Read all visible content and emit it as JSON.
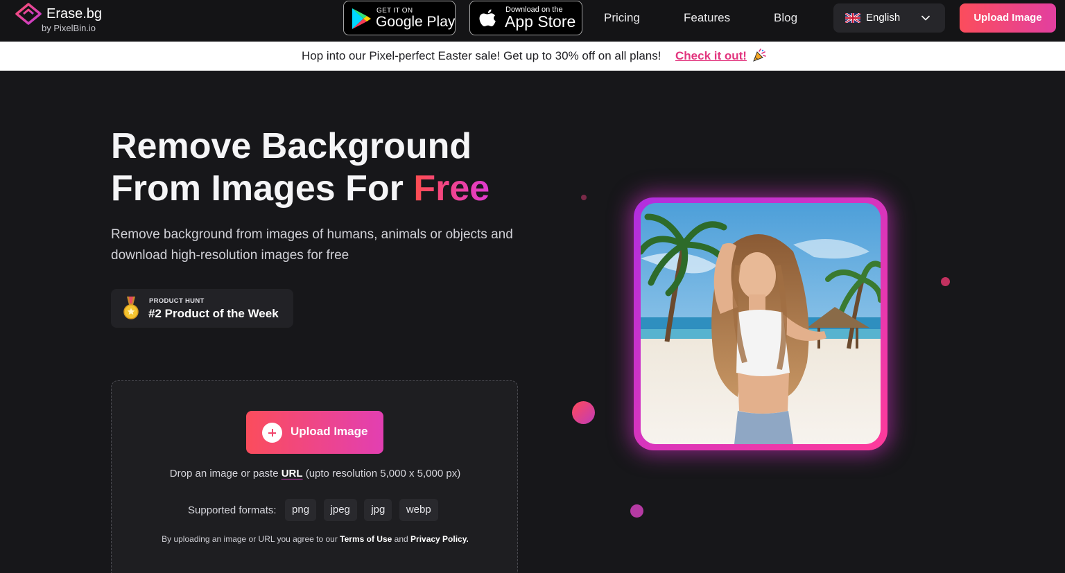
{
  "nav": {
    "logo": {
      "name": "Erase.bg",
      "by": "by PixelBin.io"
    },
    "google_play": {
      "small": "GET IT ON",
      "big": "Google Play"
    },
    "app_store": {
      "small": "Download on the",
      "big": "App Store"
    },
    "links": {
      "pricing": "Pricing",
      "features": "Features",
      "blog": "Blog"
    },
    "language": "English",
    "upload_button": "Upload Image"
  },
  "banner": {
    "text": "Hop into our Pixel-perfect Easter sale! Get up to 30% off on all plans!",
    "link": "Check it out!"
  },
  "hero": {
    "title_line1": "Remove Background",
    "title_line2_prefix": "From Images For ",
    "title_highlight": "Free",
    "subtitle": "Remove background from images of humans, animals or objects and download high-resolution images for free",
    "badge": {
      "small": "PRODUCT HUNT",
      "big": "#2 Product of the Week"
    }
  },
  "upload": {
    "button": "Upload Image",
    "drop_prefix": "Drop an image or paste ",
    "drop_url": "URL",
    "drop_suffix": " (upto resolution 5,000 x 5,000 px)",
    "formats_label": "Supported formats:",
    "formats": [
      "png",
      "jpeg",
      "jpg",
      "webp"
    ],
    "terms_prefix": "By uploading an image or URL you agree to our ",
    "terms_link": "Terms of Use",
    "terms_mid": " and ",
    "privacy_link": "Privacy Policy."
  },
  "colors": {
    "accent_gradient_start": "#fb4d5c",
    "accent_gradient_end": "#e23fa0",
    "banner_link": "#e2357e",
    "background": "#17171a"
  }
}
